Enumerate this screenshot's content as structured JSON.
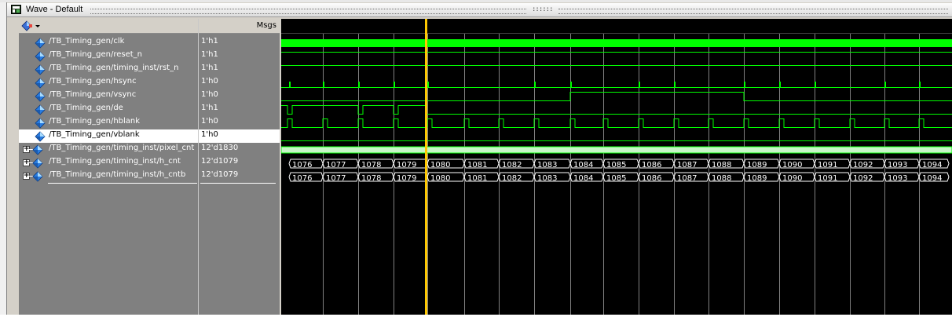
{
  "window": {
    "title": "Wave - Default",
    "grip_center_glyph": "::::::"
  },
  "header": {
    "msgs_label": "Msgs"
  },
  "colors": {
    "wave_bg": "#000000",
    "signal": "#00ff00",
    "bus_fill": "#c8f5c8",
    "cursor": "#ffc800",
    "grid": "#808080",
    "pane_bg": "#808080"
  },
  "signals": [
    {
      "name": "/TB_Timing_gen/clk",
      "value": "1'h1",
      "expandable": false,
      "selected": false
    },
    {
      "name": "/TB_Timing_gen/reset_n",
      "value": "1'h1",
      "expandable": false,
      "selected": false
    },
    {
      "name": "/TB_Timing_gen/timing_inst/rst_n",
      "value": "1'h1",
      "expandable": false,
      "selected": false
    },
    {
      "name": "/TB_Timing_gen/hsync",
      "value": "1'h0",
      "expandable": false,
      "selected": false
    },
    {
      "name": "/TB_Timing_gen/vsync",
      "value": "1'h0",
      "expandable": false,
      "selected": false
    },
    {
      "name": "/TB_Timing_gen/de",
      "value": "1'h1",
      "expandable": false,
      "selected": false
    },
    {
      "name": "/TB_Timing_gen/hblank",
      "value": "1'h0",
      "expandable": false,
      "selected": false
    },
    {
      "name": "/TB_Timing_gen/vblank",
      "value": "1'h0",
      "expandable": false,
      "selected": true
    },
    {
      "name": "/TB_Timing_gen/timing_inst/pixel_cnt",
      "value": "12'd1830",
      "expandable": true,
      "selected": false
    },
    {
      "name": "/TB_Timing_gen/timing_inst/h_cnt",
      "value": "12'd1079",
      "expandable": true,
      "selected": false
    },
    {
      "name": "/TB_Timing_gen/timing_inst/h_cntb",
      "value": "12'd1079",
      "expandable": true,
      "selected": false
    }
  ],
  "waveform": {
    "bus_values": [
      "1076",
      "1077",
      "1078",
      "1079",
      "1080",
      "1081",
      "1082",
      "1083",
      "1084",
      "1085",
      "1086",
      "1087",
      "1088",
      "1089",
      "1090",
      "1091",
      "1092",
      "1093",
      "1094"
    ],
    "cursor_index": 4
  }
}
